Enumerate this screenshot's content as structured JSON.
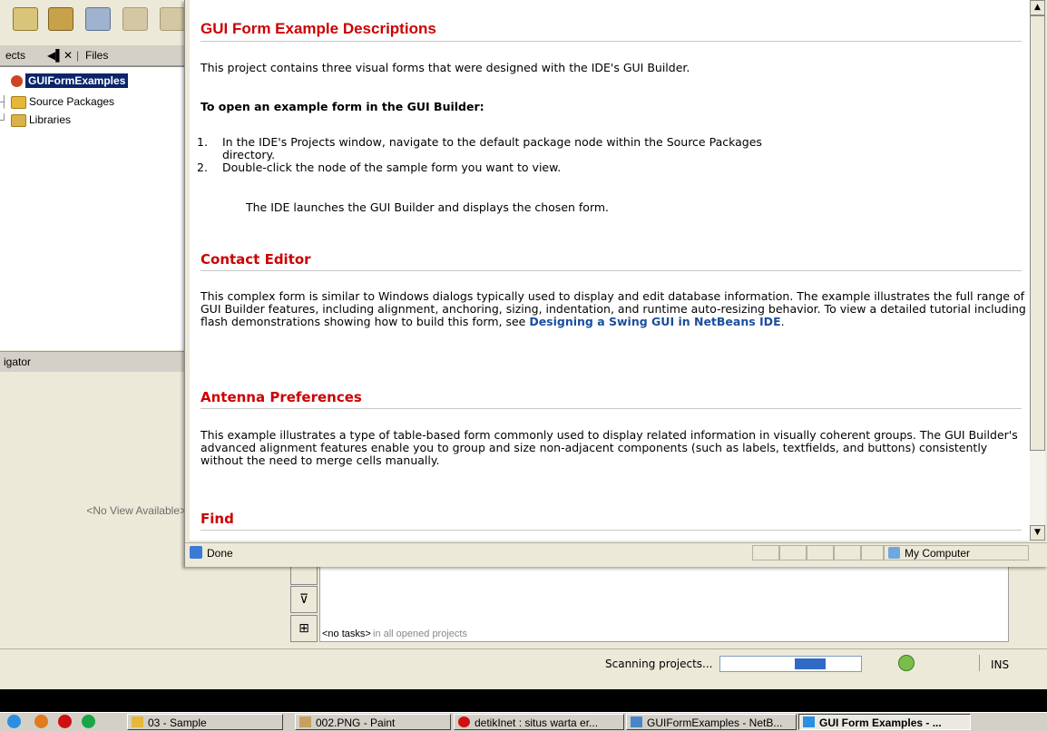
{
  "ide": {
    "projects_tab_label": "ects",
    "files_tab_label": "Files",
    "tree": [
      {
        "label": "GUIFormExamples",
        "selected": true
      },
      {
        "label": "Source Packages",
        "selected": false
      },
      {
        "label": "Libraries",
        "selected": false
      }
    ],
    "navigator_tab_label": "igator",
    "navigator_empty_text": "<No View Available>",
    "tasks_status_prefix": "<no tasks>",
    "tasks_status_suffix": " in all opened projects",
    "scanning_label": "Scanning projects...",
    "scan_progress_fraction": 0.4,
    "ins_label": "INS"
  },
  "browser": {
    "title": "GUI Form Example Descriptions",
    "intro": "This project contains three visual forms that were designed with the IDE's GUI Builder.",
    "how_to_heading": "To open an example form in the GUI Builder:",
    "steps": [
      "In the IDE's Projects window, navigate to the default package node within the Source Packages directory.",
      "Double-click the node of the sample form you want to view."
    ],
    "step_note": "The IDE launches the GUI Builder and displays the chosen form.",
    "sections": [
      {
        "heading": "Contact Editor",
        "text": "This complex form is similar to Windows dialogs typically used to display and edit database information. The example illustrates the full range of GUI Builder features, including alignment, anchoring, sizing, indentation, and runtime auto-resizing behavior. To view a detailed tutorial including flash demonstrations showing how to build this form, see ",
        "link": "Designing a Swing GUI in NetBeans IDE",
        "text_after": "."
      },
      {
        "heading": "Antenna Preferences",
        "text": "This example illustrates a type of table-based form commonly used to display related information in visually coherent groups. The GUI Builder's advanced alignment features enable you to group and size non-adjacent components (such as labels, textfields, and buttons) consistently without the need to merge cells manually."
      },
      {
        "heading": "Find"
      }
    ],
    "status_text": "Done",
    "zone_text": "My Computer"
  },
  "taskbar": {
    "items": [
      {
        "label": "03 - Sample",
        "icon": "folder-icon",
        "active": false
      },
      {
        "label": "002.PNG - Paint",
        "icon": "paint-icon",
        "active": false
      },
      {
        "label": "detikInet : situs warta er...",
        "icon": "opera-icon",
        "active": false
      },
      {
        "label": "GUIFormExamples - NetB...",
        "icon": "netbeans-icon",
        "active": false
      },
      {
        "label": "GUI Form Examples - ...",
        "icon": "ie-icon",
        "active": true
      }
    ]
  },
  "colors": {
    "heading_red": "#cc0000",
    "link_blue": "#1a4e9c",
    "selection": "#0a246a",
    "progress": "#316ac5"
  }
}
